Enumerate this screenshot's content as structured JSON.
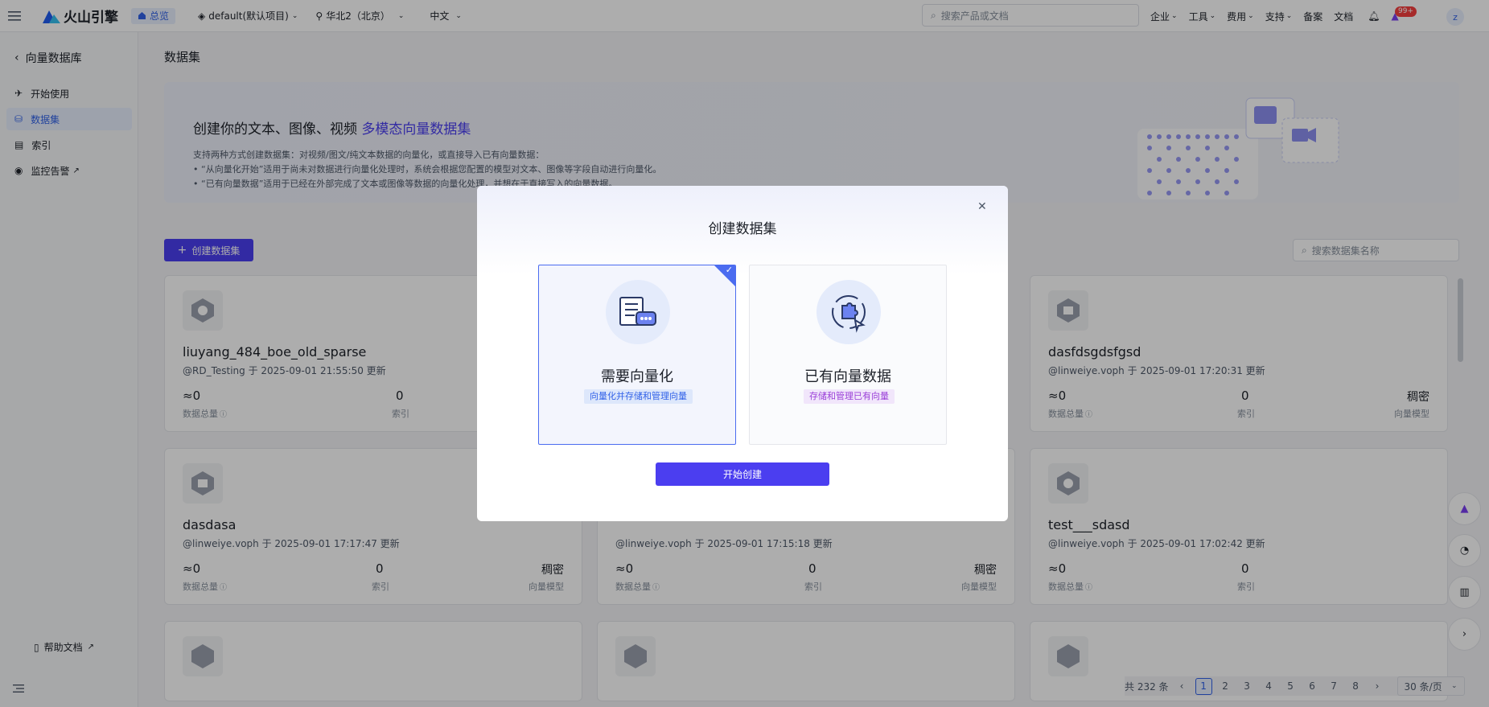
{
  "topbar": {
    "brand": "火山引擎",
    "home_label": "总览",
    "project": "default(默认项目)",
    "region": "华北2（北京）",
    "language": "中文",
    "search_placeholder": "搜索产品或文档",
    "menu": [
      "企业",
      "工具",
      "费用",
      "支持"
    ],
    "links": [
      "备案",
      "文档"
    ],
    "notification_count": "99+",
    "avatar_letter": "z"
  },
  "sidebar": {
    "title": "向量数据库",
    "items": [
      {
        "label": "开始使用",
        "icon": "rocket-icon"
      },
      {
        "label": "数据集",
        "icon": "database-icon"
      },
      {
        "label": "索引",
        "icon": "index-icon"
      },
      {
        "label": "监控告警",
        "icon": "monitor-icon"
      }
    ],
    "help": "帮助文档"
  },
  "main": {
    "page_title": "数据集",
    "banner": {
      "title_prefix": "创建你的文本、图像、视频",
      "title_highlight": "多模态向量数据集",
      "desc": "支持两种方式创建数据集：对视频/图文/纯文本数据的向量化，或直接导入已有向量数据：",
      "bullets": [
        "“从向量化开始”适用于尚未对数据进行向量化处理时，系统会根据您配置的模型对文本、图像等字段自动进行向量化。",
        "“已有向量数据”适用于已经在外部完成了文本或图像等数据的向量化处理，并想在于直接写入的向量数据。"
      ]
    },
    "create_button": "创建数据集",
    "search_placeholder": "搜索数据集名称",
    "cards": [
      {
        "name": "liuyang_484_boe_old_sparse",
        "meta": "@RD_Testing 于 2025-09-01 21:55:50 更新",
        "total": "≈0",
        "total_label": "数据总量",
        "index": "0",
        "index_label": "索引",
        "model": "",
        "model_label": ""
      },
      {
        "name": "dasfdsgdsfgsd",
        "meta": "@linweiye.voph 于 2025-09-01 17:20:31 更新",
        "total": "≈0",
        "total_label": "数据总量",
        "index": "0",
        "index_label": "索引",
        "model": "稠密",
        "model_label": "向量模型"
      },
      {
        "name": "dasdasa",
        "meta": "@linweiye.voph 于 2025-09-01 17:17:47 更新",
        "total": "≈0",
        "total_label": "数据总量",
        "index": "0",
        "index_label": "索引",
        "model": "稠密",
        "model_label": "向量模型"
      },
      {
        "name": "",
        "meta": "@linweiye.voph 于 2025-09-01 17:15:18 更新",
        "total": "≈0",
        "total_label": "数据总量",
        "index": "0",
        "index_label": "索引",
        "model": "稠密",
        "model_label": "向量模型"
      },
      {
        "name": "test___sdasd",
        "meta": "@linweiye.voph 于 2025-09-01 17:02:42 更新",
        "total": "≈0",
        "total_label": "数据总量",
        "index": "0",
        "index_label": "索引",
        "model": "",
        "model_label": ""
      }
    ],
    "pager": {
      "total": "共 232 条",
      "pages": [
        "1",
        "2",
        "3",
        "4",
        "5",
        "6",
        "7",
        "8"
      ],
      "page_size": "30 条/页"
    }
  },
  "modal": {
    "title": "创建数据集",
    "options": [
      {
        "title": "需要向量化",
        "tag": "向量化并存储和管理向量",
        "selected": true
      },
      {
        "title": "已有向量数据",
        "tag": "存储和管理已有向量",
        "selected": false
      }
    ],
    "start_button": "开始创建"
  },
  "colors": {
    "accent": "#4b3ef0",
    "link": "#3162e8",
    "tag_blue_bg": "#dde7fb",
    "tag_purple_bg": "#f1e6fb"
  }
}
